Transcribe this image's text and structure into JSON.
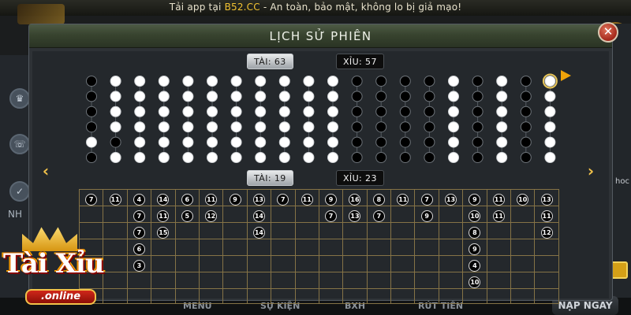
{
  "background": {
    "banner_prefix": "Tải app tại ",
    "banner_site": "B52.CC",
    "banner_suffix": " - An toàn, bảo mật, không lo bị giả mạo!",
    "left_side_text": "NH",
    "right_side_text": "hoc",
    "bottom_menu": [
      "MENU",
      "SỰ KIỆN",
      "BXH",
      "RÚT TIỀN"
    ],
    "deposit_button": "NẠP NGAY"
  },
  "modal": {
    "title": "LỊCH SỬ PHIÊN",
    "close_symbol": "✕"
  },
  "summary_top": {
    "tai_label": "TÀI",
    "tai_count": "63",
    "xiu_label": "XỈU",
    "xiu_count": "57"
  },
  "summary_bottom": {
    "tai_label": "TÀI",
    "tai_count": "19",
    "xiu_label": "XỈU",
    "xiu_count": "23"
  },
  "dot_grid": {
    "rows": 6,
    "legend": {
      "tai_color": "#ffffff",
      "xiu_color": "#000000"
    },
    "columns": [
      "XXXXWX",
      "WWWWXW",
      "WWWWWW",
      "WWWWWW",
      "WWWWWW",
      "WWWWWW",
      "WWWWWW",
      "WWWWWW",
      "WWWWWW",
      "WWWWWW",
      "WWWWWW",
      "XXXXXX",
      "XXXXXX",
      "XXXXXX",
      "XXXXXX",
      "WWWWWW",
      "XXXXXX",
      "WWWWWW",
      "XXXXXX",
      "WWWWWW"
    ],
    "latest": {
      "column": 20,
      "row": 1
    }
  },
  "nav": {
    "prev": "‹",
    "next": "›"
  },
  "number_table": {
    "rows": 7,
    "columns": [
      [
        "7"
      ],
      [
        "11"
      ],
      [
        "4",
        "7",
        "7",
        "6",
        "3"
      ],
      [
        "14",
        "11",
        "15"
      ],
      [
        "6",
        "5"
      ],
      [
        "11",
        "12"
      ],
      [
        "9"
      ],
      [
        "13",
        "14",
        "14"
      ],
      [
        "7"
      ],
      [
        "11"
      ],
      [
        "9",
        "7"
      ],
      [
        "16",
        "13"
      ],
      [
        "8",
        "7"
      ],
      [
        "11"
      ],
      [
        "7",
        "9"
      ],
      [
        "13"
      ],
      [
        "9",
        "10",
        "8",
        "9",
        "4",
        "10"
      ],
      [
        "11",
        "11"
      ],
      [
        "10"
      ],
      [
        "13",
        "11",
        "12"
      ]
    ]
  },
  "logo": {
    "main": "Tài Xỉu",
    "sub": ".online"
  }
}
